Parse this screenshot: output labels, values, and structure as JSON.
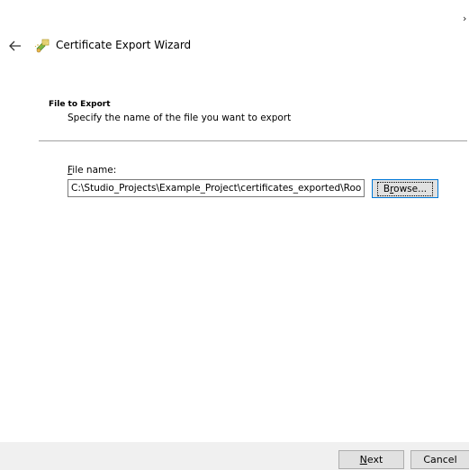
{
  "window": {
    "close_glyph": "›"
  },
  "header": {
    "title": "Certificate Export Wizard",
    "back_icon": "back-arrow-icon",
    "wizard_icon": "certificate-wizard-icon"
  },
  "section": {
    "heading": "File to Export",
    "description": "Specify the name of the file you want to export"
  },
  "file_field": {
    "label_accel": "F",
    "label_rest": "ile name:",
    "value": "C:\\Studio_Projects\\Example_Project\\certificates_exported\\RootCA"
  },
  "browse_button": {
    "pre": "B",
    "accel": "r",
    "post": "owse..."
  },
  "footer": {
    "next_accel": "N",
    "next_rest": "ext",
    "cancel_label": "Cancel"
  },
  "colors": {
    "footer_bg": "#f0f0f0",
    "focus_border": "#0078d7",
    "divider": "#a0a0a0"
  }
}
